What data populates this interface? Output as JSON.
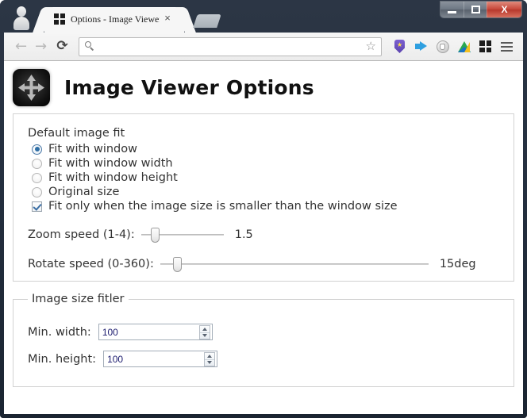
{
  "window": {
    "controls": {
      "minimize_label": "Minimize",
      "maximize_label": "Maximize",
      "close_label": "X"
    }
  },
  "tabstrip": {
    "tabs": [
      {
        "title": "Options - Image Viewer",
        "favicon": "grid-squares-icon",
        "close_label": "×",
        "active": true
      }
    ],
    "new_tab_label": "New tab"
  },
  "toolbar": {
    "back_label": "←",
    "forward_label": "→",
    "reload_label": "⟳",
    "omnibox": {
      "value": "",
      "placeholder": ""
    },
    "bookmark_star_label": "☆",
    "extensions": [
      {
        "name": "shield-star-icon"
      },
      {
        "name": "speaker-icon"
      },
      {
        "name": "hand-stop-icon"
      },
      {
        "name": "google-drive-icon"
      },
      {
        "name": "grid-squares-icon"
      }
    ],
    "menu_label": "Menu"
  },
  "page": {
    "title": "Image Viewer Options",
    "app_icon": "move-arrows-icon",
    "fit_section": {
      "group_label": "Default image fit",
      "radios": [
        {
          "label": "Fit with window",
          "checked": true
        },
        {
          "label": "Fit with window width",
          "checked": false
        },
        {
          "label": "Fit with window height",
          "checked": false
        },
        {
          "label": "Original size",
          "checked": false
        }
      ],
      "checkbox": {
        "label": "Fit only when the image size is smaller than the window size",
        "checked": true
      },
      "sliders": [
        {
          "label": "Zoom speed (1-4):",
          "value_text": "1.5",
          "min": 1,
          "max": 4,
          "value": 1.5,
          "thumb_percent": 13
        },
        {
          "label": "Rotate speed (0-360):",
          "value_text": "15deg",
          "min": 0,
          "max": 360,
          "value": 15,
          "thumb_percent": 5
        }
      ]
    },
    "filter_section": {
      "legend": "Image size fitler",
      "fields": [
        {
          "label": "Min. width:",
          "value": "100",
          "placeholder": ""
        },
        {
          "label": "Min. height:",
          "value": "100",
          "placeholder": ""
        }
      ]
    }
  },
  "colors": {
    "frame": "#1b2533",
    "accent_blue": "#2f6ea5",
    "input_text": "#1b1b6e",
    "panel_border": "#d2d2d2"
  }
}
